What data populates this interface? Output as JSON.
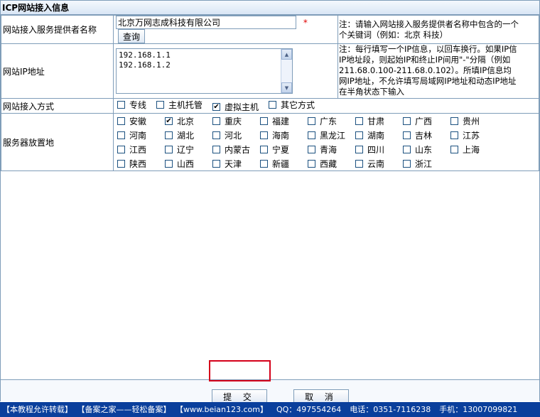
{
  "window": {
    "title": "ICP网站接入信息"
  },
  "form": {
    "provider": {
      "label": "网站接入服务提供者名称",
      "value": "北京万网志成科技有限公司",
      "required_mark": "*",
      "query_button": "查询",
      "note": [
        "注：请输入网站接入服务提供者名称中包含的一个",
        "个关键词（例如：北京 科技）"
      ]
    },
    "ip": {
      "label": "网站IP地址",
      "value": "192.168.1.1\n192.168.1.2",
      "note": [
        "注：每行填写一个IP信息，以回车换行。如果IP信",
        "IP地址段，则起始IP和终止IP间用\"-\"分隔（例如",
        "211.68.0.100-211.68.0.102）。所填IP信息均",
        "网IP地址，不允许填写局域网IP地址和动态IP地址",
        "在半角状态下输入"
      ]
    },
    "access_method": {
      "label": "网站接入方式",
      "options": [
        {
          "label": "专线",
          "checked": false
        },
        {
          "label": "主机托管",
          "checked": false
        },
        {
          "label": "虚拟主机",
          "checked": true
        },
        {
          "label": "其它方式",
          "checked": false
        }
      ]
    },
    "server_location": {
      "label": "服务器放置地",
      "provinces": [
        {
          "label": "安徽",
          "checked": false
        },
        {
          "label": "北京",
          "checked": true
        },
        {
          "label": "重庆",
          "checked": false
        },
        {
          "label": "福建",
          "checked": false
        },
        {
          "label": "广东",
          "checked": false
        },
        {
          "label": "甘肃",
          "checked": false
        },
        {
          "label": "广西",
          "checked": false
        },
        {
          "label": "贵州",
          "checked": false
        },
        {
          "label": "河南",
          "checked": false
        },
        {
          "label": "湖北",
          "checked": false
        },
        {
          "label": "河北",
          "checked": false
        },
        {
          "label": "海南",
          "checked": false
        },
        {
          "label": "黑龙江",
          "checked": false
        },
        {
          "label": "湖南",
          "checked": false
        },
        {
          "label": "吉林",
          "checked": false
        },
        {
          "label": "江苏",
          "checked": false
        },
        {
          "label": "江西",
          "checked": false
        },
        {
          "label": "辽宁",
          "checked": false
        },
        {
          "label": "内蒙古",
          "checked": false
        },
        {
          "label": "宁夏",
          "checked": false
        },
        {
          "label": "青海",
          "checked": false
        },
        {
          "label": "四川",
          "checked": false
        },
        {
          "label": "山东",
          "checked": false
        },
        {
          "label": "上海",
          "checked": false
        },
        {
          "label": "陕西",
          "checked": false
        },
        {
          "label": "山西",
          "checked": false
        },
        {
          "label": "天津",
          "checked": false
        },
        {
          "label": "新疆",
          "checked": false
        },
        {
          "label": "西藏",
          "checked": false
        },
        {
          "label": "云南",
          "checked": false
        },
        {
          "label": "浙江",
          "checked": false
        }
      ]
    }
  },
  "actions": {
    "submit": "提 交",
    "cancel": "取 消"
  },
  "footer": {
    "items": [
      "【本教程允许转载】",
      "【备案之家——轻松备案】",
      "【www.beian123.com】",
      "QQ：497554264",
      "电话：0351-7116238",
      "手机：13007099821"
    ]
  },
  "colors": {
    "highlight": "#d4001a",
    "footer_bg": "#0a3f9c",
    "border": "#7f9db9"
  },
  "icons": {
    "scroll_up": "triangle-up",
    "scroll_down": "triangle-down",
    "check": "checkmark"
  }
}
